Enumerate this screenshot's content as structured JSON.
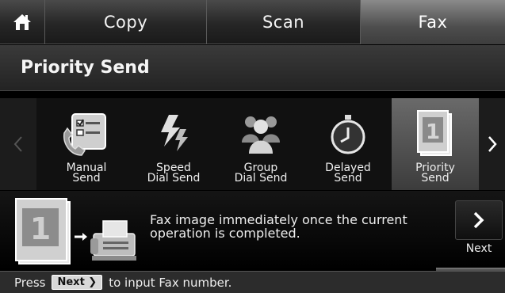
{
  "tabs": {
    "home_icon": "home-icon",
    "items": [
      {
        "label": "Copy"
      },
      {
        "label": "Scan"
      },
      {
        "label": "Fax",
        "active": true
      }
    ]
  },
  "title": "Priority Send",
  "carousel": {
    "items": [
      {
        "label": "Manual\nSend",
        "icon": "manual-send-icon"
      },
      {
        "label": "Speed\nDial Send",
        "icon": "speed-dial-icon"
      },
      {
        "label": "Group\nDial Send",
        "icon": "group-dial-icon"
      },
      {
        "label": "Delayed\nSend",
        "icon": "delayed-send-icon"
      },
      {
        "label": "Priority\nSend",
        "icon": "priority-send-icon",
        "selected": true
      }
    ]
  },
  "description": {
    "text": "Fax image immediately once the current operation is completed.",
    "next_label": "Next"
  },
  "status": {
    "prefix": "Press",
    "key_label": "Next",
    "suffix": "to input Fax number."
  }
}
